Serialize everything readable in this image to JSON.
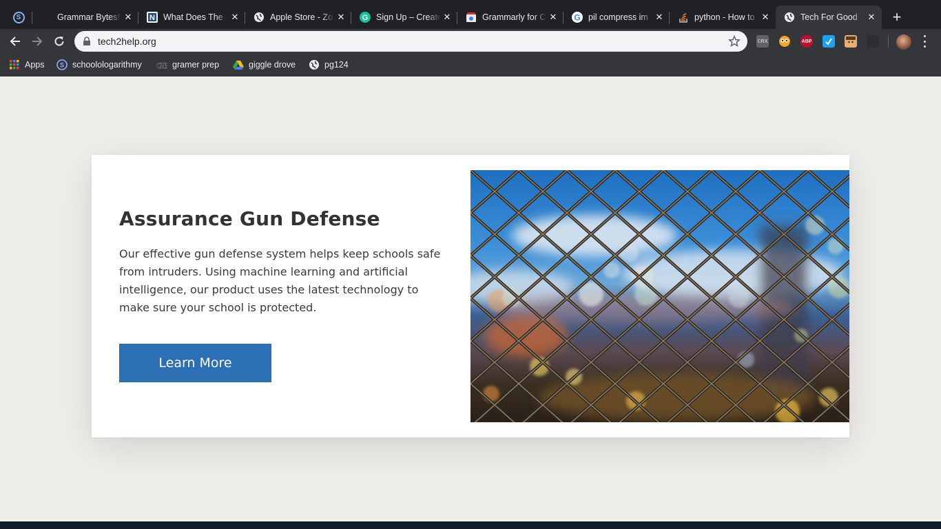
{
  "browser": {
    "tabs": [
      {
        "title": "Grammar Bytes!",
        "icon": "blank-page-icon",
        "active": false
      },
      {
        "title": "What Does The",
        "icon": "n-logo-icon",
        "active": false
      },
      {
        "title": "Apple Store - Zo",
        "icon": "globe-icon",
        "active": false
      },
      {
        "title": "Sign Up – Create",
        "icon": "grammarly-g-icon",
        "active": false
      },
      {
        "title": "Grammarly for C",
        "icon": "chrome-store-icon",
        "active": false
      },
      {
        "title": "pil compress im",
        "icon": "google-g-icon",
        "active": false
      },
      {
        "title": "python - How to",
        "icon": "stackoverflow-icon",
        "active": false
      },
      {
        "title": "Tech For Good",
        "icon": "globe-icon",
        "active": true
      }
    ],
    "address": {
      "url": "tech2help.org"
    },
    "extensions": [
      {
        "name": "crx-extension-icon",
        "label": "CRX",
        "color": "#5f6368"
      },
      {
        "name": "owl-extension-icon",
        "label": "",
        "color": "#f5a623"
      },
      {
        "name": "adblock-plus-icon",
        "label": "ABP",
        "color": "#c70d2c"
      },
      {
        "name": "blue-extension-icon",
        "label": "",
        "color": "#1da1f2"
      },
      {
        "name": "face-extension-icon",
        "label": "",
        "color": "#e8b070"
      },
      {
        "name": "dark-extension-icon",
        "label": "",
        "color": "#2d2e31"
      }
    ],
    "bookmarks": [
      {
        "label": "Apps",
        "icon": "apps-grid-icon"
      },
      {
        "label": "schoolologarithmy",
        "icon": "s-circle-icon"
      },
      {
        "label": "gramer prep",
        "icon": "gb-logo-icon"
      },
      {
        "label": "giggle drove",
        "icon": "google-drive-icon"
      },
      {
        "label": "pg124",
        "icon": "globe-icon"
      }
    ]
  },
  "page": {
    "heading": "Assurance Gun Defense",
    "description": "Our effective gun defense system helps keep schools safe from intruders. Using machine learning and artificial intelligence, our product uses the latest technology to make sure your school is protected.",
    "cta_label": "Learn More",
    "colors": {
      "background": "#efeeea",
      "card": "#ffffff",
      "heading": "#333333",
      "button": "#2c6fb4",
      "footer": "#0d1b2a"
    }
  }
}
